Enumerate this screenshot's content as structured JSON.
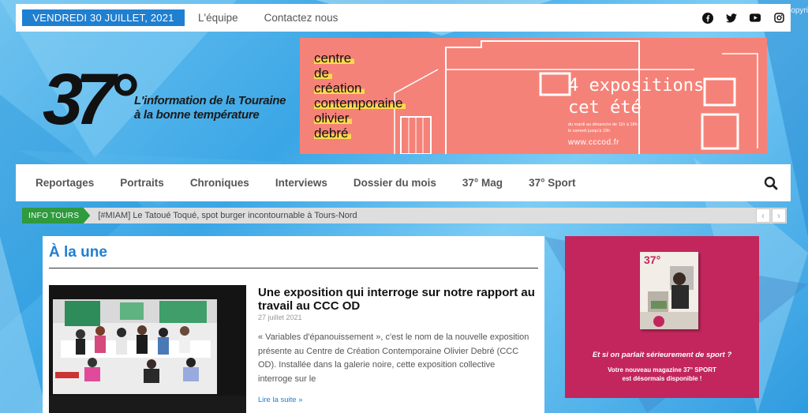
{
  "topbar": {
    "date": "VENDREDI 30 JUILLET, 2021",
    "links": [
      "L'équipe",
      "Contactez nous"
    ],
    "socials": [
      "facebook-icon",
      "twitter-icon",
      "youtube-icon",
      "instagram-icon"
    ],
    "corner_text": "opyri"
  },
  "logo": {
    "mark": "37°",
    "tagline_line1": "L'information de la Touraine",
    "tagline_line2": "à la bonne température"
  },
  "banner": {
    "lines": [
      "centre",
      "de",
      "création",
      "contemporaine",
      "olivier",
      "debré"
    ],
    "title_line1": "4 expositions",
    "title_line2": "cet été",
    "small_line1": "du mardi au dimanche de 11h à 18h",
    "small_line2": "le samedi jusqu'à 19h",
    "url": "www.cccod.fr",
    "color": "#f58278"
  },
  "nav": {
    "items": [
      "Reportages",
      "Portraits",
      "Chroniques",
      "Interviews",
      "Dossier du mois",
      "37° Mag",
      "37° Sport"
    ]
  },
  "ticker": {
    "label": "INFO TOURS",
    "text": "[#MIAM] Le Tatoué Toqué, spot burger incontournable à Tours-Nord",
    "prev": "‹",
    "next": "›"
  },
  "main": {
    "section_title": "À la une",
    "article": {
      "title": "Une exposition qui interroge sur notre rapport au travail au CCC OD",
      "date": "27 juillet 2021",
      "excerpt": "« Variables d'épanouissement », c'est le nom de la nouvelle exposition présente au Centre de Création Contemporaine Olivier Debré (CCC OD). Installée dans la galerie noire, cette exposition collective interroge sur le",
      "read_more": "Lire la suite »"
    }
  },
  "side_ad": {
    "mag_logo": "37°",
    "headline": "Et si on parlait sérieurement de sport ?",
    "sub_line1": "Votre nouveau magazine 37° SPORT",
    "sub_line2": "est désormais disponible !",
    "color": "#c2265c"
  },
  "colors": {
    "accent": "#1f7fd1",
    "ticker_badge": "#2f9a3e"
  }
}
